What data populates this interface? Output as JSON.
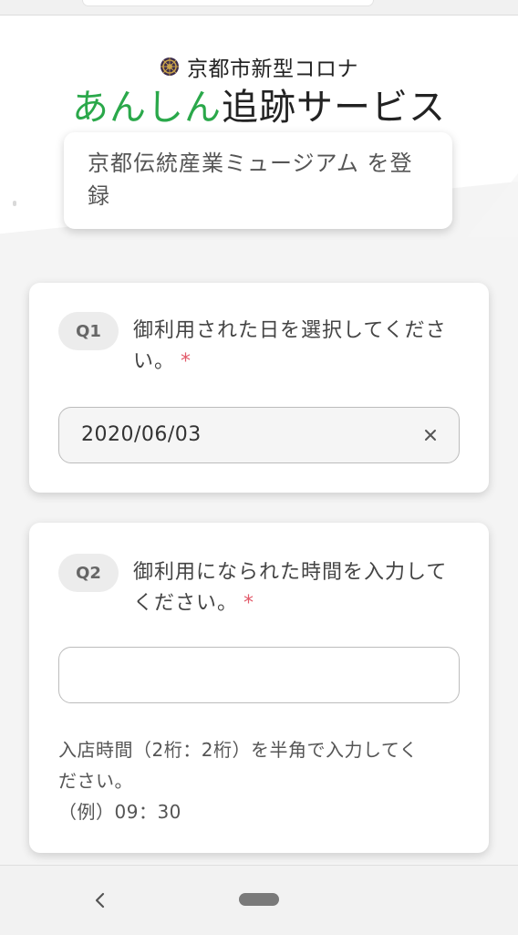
{
  "header": {
    "logo_subtitle": "京都市新型コロナ",
    "logo_green": "あんしん",
    "logo_rest": "追跡サービス"
  },
  "venue": {
    "register_text": "京都伝統産業ミュージアム を登録"
  },
  "questions": [
    {
      "badge": "Q1",
      "text": "御利用された日を選択してください。",
      "required_mark": "*",
      "value": "2020/06/03",
      "clear_icon": "close-icon"
    },
    {
      "badge": "Q2",
      "text": "御利用になられた時間を入力してください。",
      "required_mark": "*",
      "value": "",
      "hint_line1": "入店時間（2桁：2桁）を半角で入力してく",
      "hint_line2": "ださい。",
      "hint_line3": "（例）09：30"
    }
  ],
  "nav": {
    "back_icon": "chevron-left-icon",
    "home_icon": "home-pill-icon"
  },
  "colors": {
    "accent_green": "#2aa84a",
    "required_red": "#e25a6a"
  }
}
